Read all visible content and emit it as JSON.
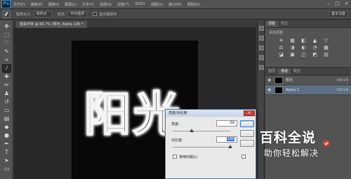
{
  "app": {
    "logo": "Ps"
  },
  "menubar": {
    "items": [
      "文件(F)",
      "编辑(E)",
      "图像(I)",
      "图层(L)",
      "文字(Y)",
      "选择(S)",
      "滤镜(T)",
      "3D(D)",
      "视图(V)",
      "窗口(W)",
      "帮助(H)"
    ],
    "window_controls": [
      "–",
      "□",
      "×"
    ]
  },
  "options_bar": {
    "sample_size_label": "取样大小:",
    "sample_size_value": "取样点",
    "sample_label": "样本:",
    "sample_value": "所有图层",
    "show_ring_label": "显示取样环",
    "workspace_value": "基本功能"
  },
  "document": {
    "tab_label": "金属字体 @ 66.7% (阳光, Alpha 1/8) *",
    "canvas_text": "阳光"
  },
  "panels": {
    "tabs": [
      "调整",
      "样式"
    ],
    "adjustments_title": "添加调整",
    "adjust_icons_row1": [
      "☀",
      "▦",
      "◧",
      "▲",
      "▽"
    ],
    "adjust_icons_row2": [
      "⚖",
      "◑",
      "◐",
      "◔",
      "▩"
    ],
    "adjust_icons_row3": [
      "◪",
      "▣",
      "◫",
      "◩",
      "▤"
    ]
  },
  "channels": {
    "tabs": [
      "图层",
      "通道",
      "路径"
    ],
    "rows": [
      {
        "name": "阳光",
        "shortcut": "Ctrl+5",
        "selected": false
      },
      {
        "name": "Alpha 1",
        "shortcut": "Ctrl+6",
        "selected": true
      }
    ]
  },
  "dialog": {
    "title": "亮度/对比度",
    "brightness_label": "亮度:",
    "brightness_value": "-59",
    "contrast_label": "对比度:",
    "contrast_value": "100",
    "legacy_label": "使用旧版(L)",
    "close_glyph": "×"
  },
  "watermark": {
    "title": "百科全说",
    "subtitle": "助你轻松解决"
  }
}
